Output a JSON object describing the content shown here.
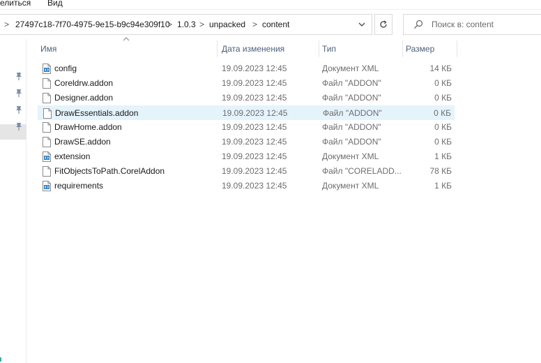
{
  "ribbon": {
    "share_label": "елиться",
    "view_label": "Вид"
  },
  "address": {
    "breadcrumbs": [
      "27497c18-7f70-4975-9e15-b9c94e309f10",
      "1.0.3",
      "unpacked",
      "content"
    ],
    "separator": ">"
  },
  "search": {
    "placeholder": "Поиск в: content"
  },
  "columns": {
    "name": "Имя",
    "date": "Дата изменения",
    "type": "Тип",
    "size": "Размер"
  },
  "files": [
    {
      "name": "config",
      "date": "19.09.2023 12:45",
      "type": "Документ XML",
      "size": "14 КБ",
      "icon": "xml-file-icon"
    },
    {
      "name": "Coreldrw.addon",
      "date": "19.09.2023 12:45",
      "type": "Файл \"ADDON\"",
      "size": "0 КБ",
      "icon": "blank-file-icon"
    },
    {
      "name": "Designer.addon",
      "date": "19.09.2023 12:45",
      "type": "Файл \"ADDON\"",
      "size": "0 КБ",
      "icon": "blank-file-icon"
    },
    {
      "name": "DrawEssentials.addon",
      "date": "19.09.2023 12:45",
      "type": "Файл \"ADDON\"",
      "size": "0 КБ",
      "icon": "blank-file-icon",
      "selected": true
    },
    {
      "name": "DrawHome.addon",
      "date": "19.09.2023 12:45",
      "type": "Файл \"ADDON\"",
      "size": "0 КБ",
      "icon": "blank-file-icon"
    },
    {
      "name": "DrawSE.addon",
      "date": "19.09.2023 12:45",
      "type": "Файл \"ADDON\"",
      "size": "0 КБ",
      "icon": "blank-file-icon"
    },
    {
      "name": "extension",
      "date": "19.09.2023 12:45",
      "type": "Документ XML",
      "size": "1 КБ",
      "icon": "xml-file-icon"
    },
    {
      "name": "FitObjectsToPath.CorelAddon",
      "date": "19.09.2023 12:45",
      "type": "Файл \"CORELADD...",
      "size": "78 КБ",
      "icon": "blank-file-icon"
    },
    {
      "name": "requirements",
      "date": "19.09.2023 12:45",
      "type": "Документ XML",
      "size": "1 КБ",
      "icon": "xml-file-icon"
    }
  ],
  "colors": {
    "header_text": "#4c607a",
    "selected_row": "#e5f3fb",
    "secondary_text": "#6d6d6d"
  }
}
